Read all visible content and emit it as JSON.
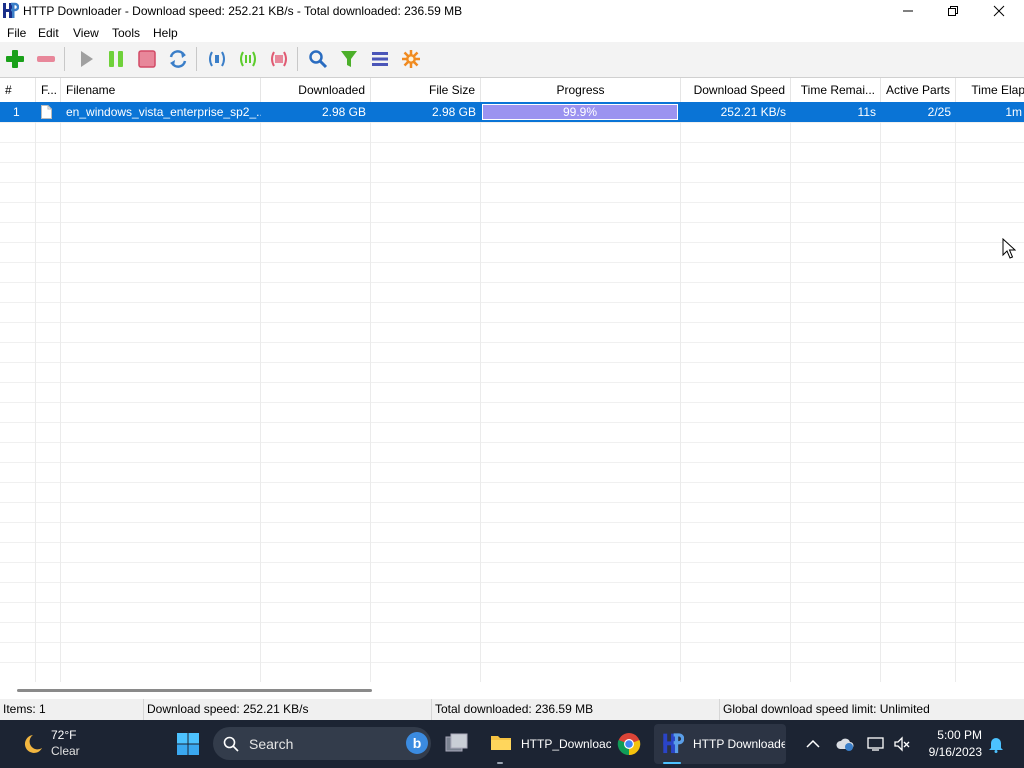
{
  "window": {
    "title": "HTTP Downloader - Download speed: 252.21 KB/s - Total downloaded: 236.59 MB"
  },
  "menu": [
    "File",
    "Edit",
    "View",
    "Tools",
    "Help"
  ],
  "toolbar": [
    {
      "name": "add-icon",
      "color": "#1aa01a"
    },
    {
      "name": "remove-icon",
      "color": "#e0506a"
    },
    {
      "name": "start-icon",
      "color": "#8a8a8a"
    },
    {
      "name": "pause-icon",
      "color": "#5ccc2c"
    },
    {
      "name": "stop-icon",
      "color": "#e05a72"
    },
    {
      "name": "restart-icon",
      "color": "#3a7ec8"
    },
    {
      "name": "pause-active-icon",
      "color": "#3a7ec8"
    },
    {
      "name": "start-queued-icon",
      "color": "#5ccc2c"
    },
    {
      "name": "stop-all-icon",
      "color": "#e05a72"
    },
    {
      "name": "search-icon",
      "color": "#2a6cc0"
    },
    {
      "name": "filter-icon",
      "color": "#4caf2a"
    },
    {
      "name": "list-icon",
      "color": "#4a55b8"
    },
    {
      "name": "options-icon",
      "color": "#f08a20"
    }
  ],
  "columns": [
    "#",
    "F...",
    "Filename",
    "Downloaded",
    "File Size",
    "Progress",
    "Download Speed",
    "Time Remai...",
    "Active Parts",
    "Time Elaps"
  ],
  "rows": [
    {
      "num": "1",
      "filename": "en_windows_vista_enterprise_sp2_...",
      "downloaded": "2.98 GB",
      "file_size": "2.98 GB",
      "progress_label": "99.9%",
      "progress_value": 99.9,
      "download_speed": "252.21 KB/s",
      "time_remaining": "11s",
      "active_parts": "2/25",
      "time_elapsed": "1m"
    }
  ],
  "status": {
    "items": "Items: 1",
    "download_speed": "Download speed: 252.21 KB/s",
    "total_downloaded": "Total downloaded: 236.59 MB",
    "speed_limit": "Global download speed limit: Unlimited"
  },
  "taskbar": {
    "weather_temp": "72°F",
    "weather_condition": "Clear",
    "search_placeholder": "Search",
    "apps": [
      {
        "name": "file-explorer",
        "label": "HTTP_Downloac"
      },
      {
        "name": "chrome",
        "label": ""
      },
      {
        "name": "http-downloader",
        "label": "HTTP Downloade"
      }
    ],
    "time": "5:00 PM",
    "date": "9/16/2023"
  },
  "colors": {
    "selection": "#0a74d6",
    "progress_fill": "#9b93f0",
    "taskbar": "#1c2433"
  }
}
